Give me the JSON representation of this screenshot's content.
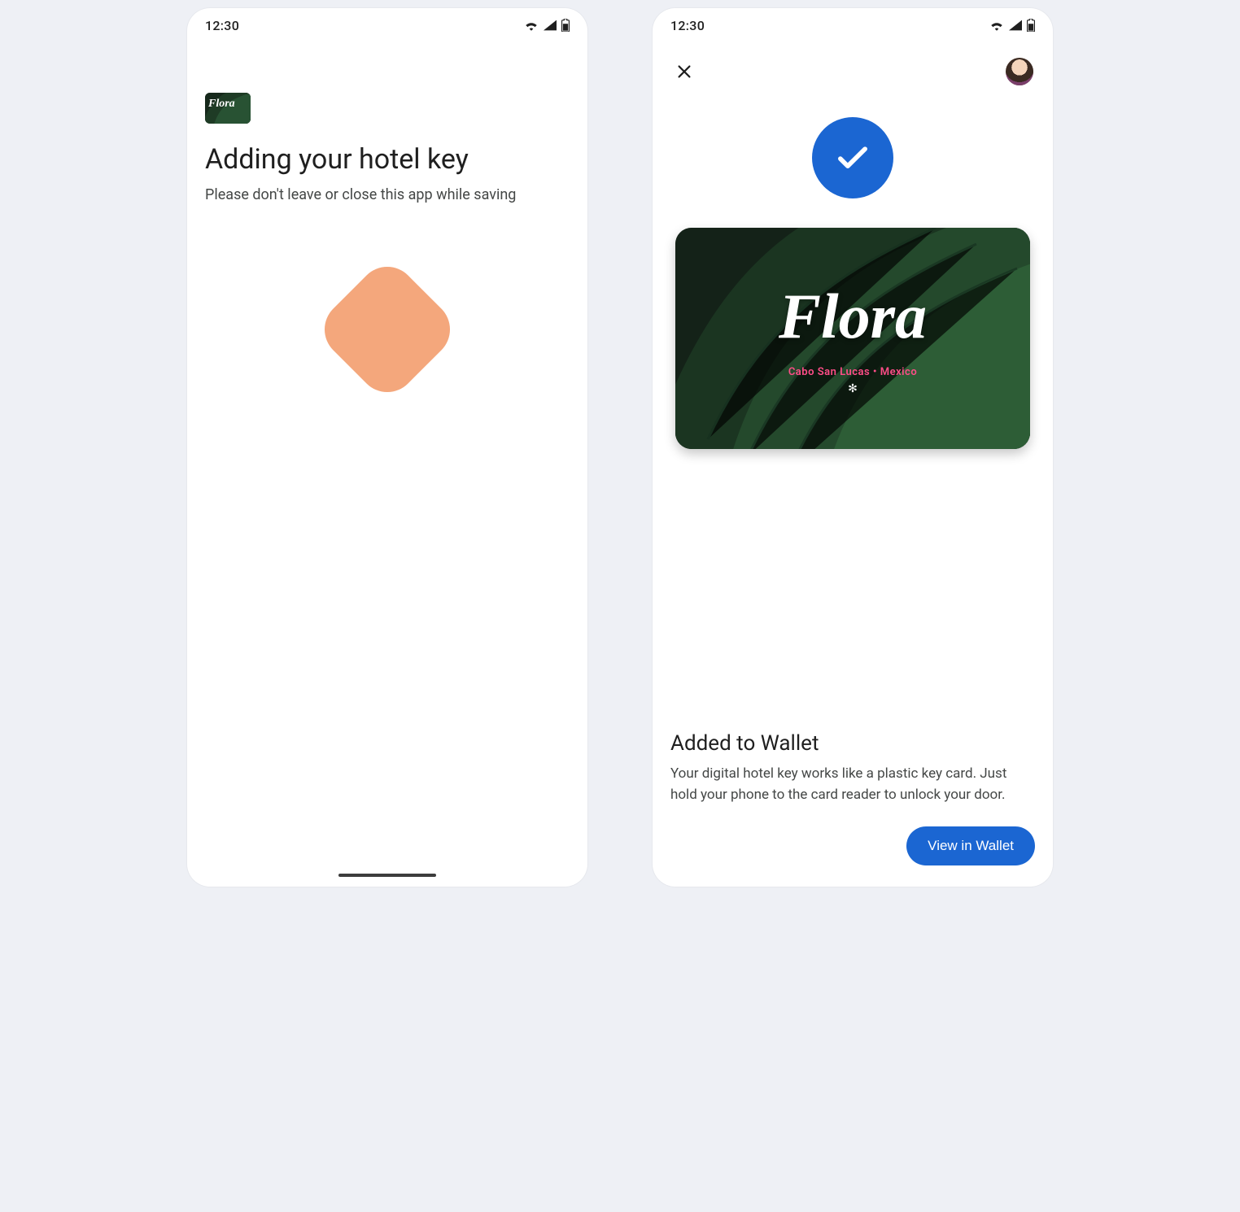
{
  "status": {
    "time": "12:30"
  },
  "left": {
    "brand": "Flora",
    "title": "Adding your hotel key",
    "subtitle": "Please don't leave or close this app while saving"
  },
  "right": {
    "card": {
      "brand": "Flora",
      "location": "Cabo San Lucas  •  Mexico"
    },
    "done_title": "Added to Wallet",
    "done_text": "Your digital hotel key works like a plastic key card. Just hold your phone to the card reader to unlock your door.",
    "cta": "View in Wallet"
  }
}
